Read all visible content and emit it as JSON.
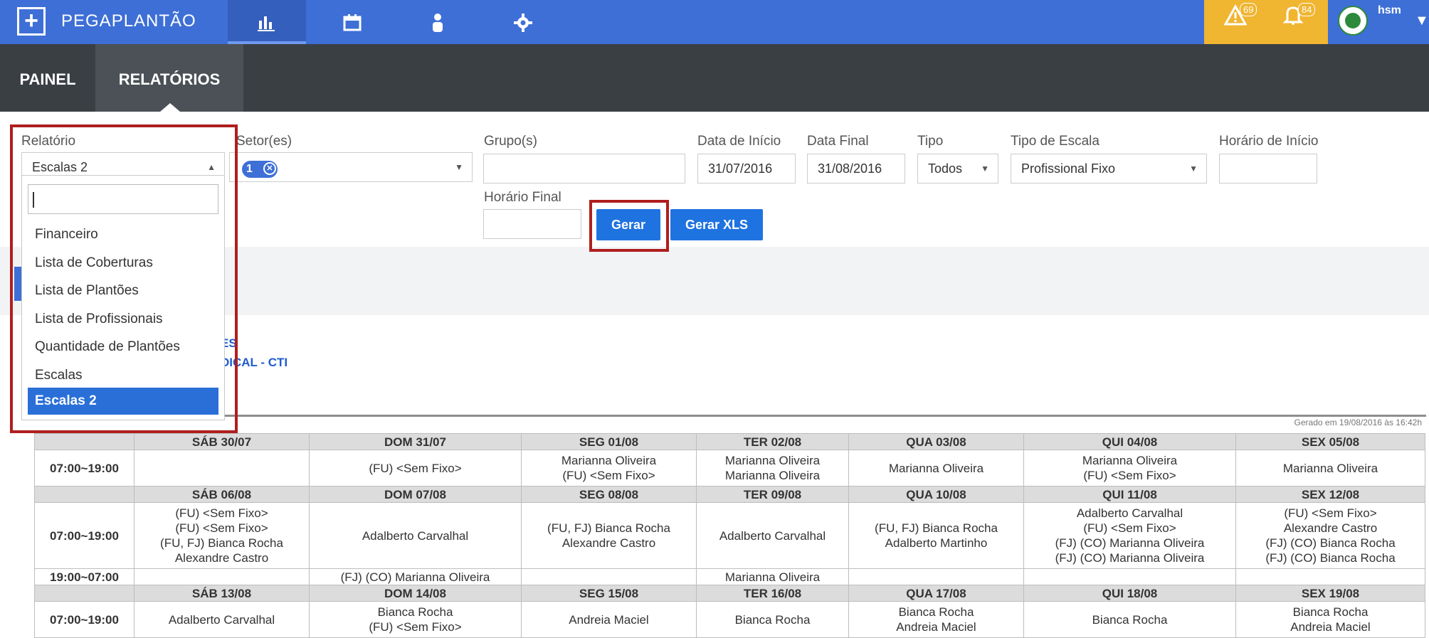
{
  "app": {
    "brand": "PEGAPLANTÃO",
    "logo_icon": "plus-square-icon",
    "nav_icons": [
      "bar-chart-icon",
      "calendar-icon",
      "user-icon",
      "gear-icon"
    ],
    "alerts": [
      {
        "icon": "warning-icon",
        "count": "69"
      },
      {
        "icon": "bell-icon",
        "count": "84"
      }
    ],
    "user": {
      "name": "hsm",
      "avatar_icon": "hospital-avatar-icon"
    },
    "colors": {
      "primary": "#3e6fd6",
      "alerts_bg": "#f0b531",
      "subnav_bg": "#3a3f44",
      "button": "#1f73e0",
      "highlight_box": "#b01e1e"
    }
  },
  "subnav": {
    "items": [
      "PAINEL",
      "RELATÓRIOS"
    ],
    "active": "RELATÓRIOS"
  },
  "filters": {
    "relatorio_label": "Relatório",
    "relatorio_value": "Escalas 2",
    "setor_label": "Setor(es)",
    "setor_badge": "1",
    "grupo_label": "Grupo(s)",
    "grupo_value": "",
    "data_inicio_label": "Data de Início",
    "data_inicio_value": "31/07/2016",
    "data_final_label": "Data Final",
    "data_final_value": "31/08/2016",
    "tipo_label": "Tipo",
    "tipo_value": "Todos",
    "tipo_escala_label": "Tipo de Escala",
    "tipo_escala_value": "Profissional Fixo",
    "horario_inicio_label": "Horário de Início",
    "horario_inicio_value": "",
    "horario_final_label": "Horário Final",
    "horario_final_value": "",
    "gerar_label": "Gerar",
    "gerar_xls_label": "Gerar XLS"
  },
  "dropdown": {
    "items": [
      "Financeiro",
      "Lista de Coberturas",
      "Lista de Plantões",
      "Lista de Profissionais",
      "Quantidade de Plantões",
      "Escalas",
      "Escalas 2"
    ],
    "selected": "Escalas 2"
  },
  "partial_text": {
    "line1": "ES",
    "line2": "DICAL - CTI"
  },
  "report": {
    "generated": "Gerado em 19/08/2016 às 16:42h",
    "weeks": [
      {
        "days": [
          "SÁB 30/07",
          "DOM 31/07",
          "SEG 01/08",
          "TER 02/08",
          "QUA 03/08",
          "QUI 04/08",
          "SEX 05/08"
        ],
        "rows": [
          {
            "time": "07:00~19:00",
            "cells": [
              "",
              "(FU) <Sem Fixo>",
              "Marianna Oliveira\n(FU) <Sem Fixo>",
              "Marianna Oliveira\nMarianna Oliveira",
              "Marianna Oliveira",
              "Marianna Oliveira\n(FU) <Sem Fixo>",
              "Marianna Oliveira"
            ]
          }
        ]
      },
      {
        "days": [
          "SÁB 06/08",
          "DOM 07/08",
          "SEG 08/08",
          "TER 09/08",
          "QUA 10/08",
          "QUI 11/08",
          "SEX 12/08"
        ],
        "rows": [
          {
            "time": "07:00~19:00",
            "cells": [
              "(FU) <Sem Fixo>\n(FU) <Sem Fixo>\n(FU, FJ) Bianca Rocha\nAlexandre Castro",
              "Adalberto Carvalhal",
              "(FU, FJ) Bianca Rocha\nAlexandre Castro",
              "Adalberto Carvalhal",
              "(FU, FJ) Bianca Rocha\nAdalberto Martinho",
              "Adalberto Carvalhal\n(FU) <Sem Fixo>\n(FJ) (CO) Marianna Oliveira\n(FJ) (CO) Marianna Oliveira",
              "(FU) <Sem Fixo>\nAlexandre Castro\n(FJ) (CO) Bianca Rocha\n(FJ) (CO) Bianca Rocha"
            ]
          },
          {
            "time": "19:00~07:00",
            "cells": [
              "",
              "(FJ) (CO) Marianna Oliveira",
              "",
              "Marianna Oliveira",
              "",
              "",
              ""
            ]
          }
        ]
      },
      {
        "days": [
          "SÁB 13/08",
          "DOM 14/08",
          "SEG 15/08",
          "TER 16/08",
          "QUA 17/08",
          "QUI 18/08",
          "SEX 19/08"
        ],
        "rows": [
          {
            "time": "07:00~19:00",
            "cells": [
              "Adalberto Carvalhal",
              "Bianca Rocha\n(FU) <Sem Fixo>",
              "Andreia Maciel",
              "Bianca Rocha",
              "Bianca Rocha\nAndreia Maciel",
              "Bianca Rocha",
              "Bianca Rocha\nAndreia Maciel"
            ]
          }
        ]
      }
    ]
  }
}
